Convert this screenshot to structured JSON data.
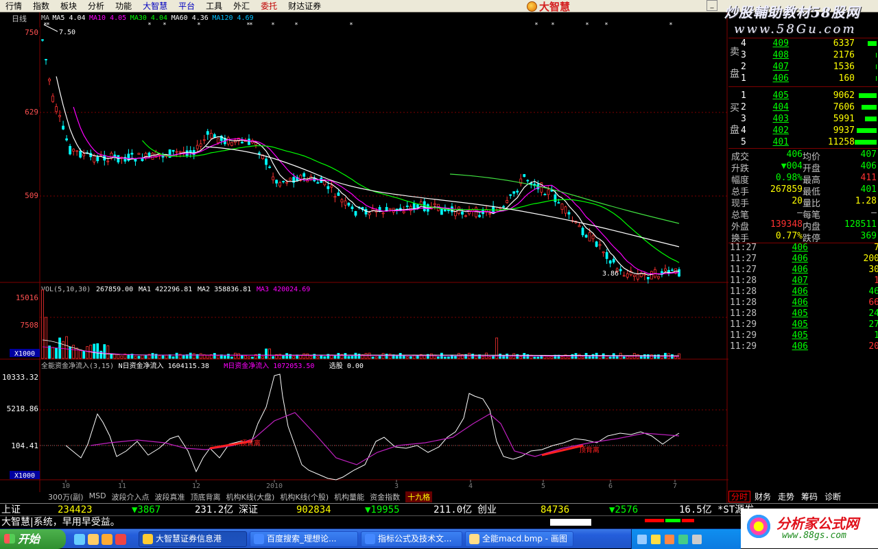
{
  "menu": [
    "行情",
    "指数",
    "板块",
    "分析",
    "功能",
    "大智慧",
    "平台",
    "工具",
    "外汇",
    "委托",
    "财达证券"
  ],
  "menu_colors": [
    "#000",
    "#000",
    "#000",
    "#000",
    "#000",
    "#0000c0",
    "#0000c0",
    "#000",
    "#000",
    "#c00000",
    "#000"
  ],
  "logo": "大智慧",
  "watermark": {
    "line1": "炒股輔助教材58股网",
    "line2": "www.58Gu.com"
  },
  "chart": {
    "period": "日线",
    "ma_legend": [
      {
        "text": "MA",
        "color": "#c0c0c0"
      },
      {
        "text": "MA5 4.04",
        "color": "#ffffff"
      },
      {
        "text": "MA10 4.05",
        "color": "#ff00ff"
      },
      {
        "text": "MA30 4.04",
        "color": "#00ff00"
      },
      {
        "text": "MA60 4.36",
        "color": "#ffffff"
      },
      {
        "text": "MA120 4.69",
        "color": "#00c0ff"
      }
    ],
    "price_axis": [
      "750",
      "629",
      "509"
    ],
    "high_note": "7.50",
    "low_note": "3.86",
    "vol_legend": [
      {
        "text": "VOL(5,10,30)",
        "color": "#c0c0c0"
      },
      {
        "text": "267859.00",
        "color": "#ffffff"
      },
      {
        "text": "MA1 422296.81",
        "color": "#ffffff"
      },
      {
        "text": "MA2 358836.81",
        "color": "#ffffff"
      },
      {
        "text": "MA3 420024.69",
        "color": "#ff00ff"
      }
    ],
    "vol_axis": [
      "15016",
      "7508",
      "X1000"
    ],
    "ind_legend": [
      {
        "text": "全能资金净流入(3,15)",
        "color": "#c0c0c0"
      },
      {
        "text": "N日资金净流入 1604115.38",
        "color": "#ffffff"
      },
      {
        "text": "M日资金净流入 1072053.50",
        "color": "#ff00ff"
      },
      {
        "text": "选股 0.00",
        "color": "#ffffff"
      }
    ],
    "ind_axis": [
      "10333.32",
      "5218.86",
      "104.41",
      "X1000"
    ],
    "divergence_label": "顶背离",
    "year_label": "2010",
    "date_ticks": [
      "10",
      "11",
      "12",
      "2010",
      "3",
      "4",
      "5",
      "6",
      "7"
    ],
    "colors": {
      "up": "#ff3232",
      "down": "#00ffff",
      "grid": "#800000",
      "ma5": "#ffffff",
      "ma10": "#ff00ff",
      "ma30": "#00ff00",
      "ma60": "#ffffff"
    }
  },
  "chart_data": {
    "type": "candlestick",
    "y_axis_ticks": [
      750,
      629,
      509
    ],
    "high": 7.5,
    "low": 3.86
  },
  "order_book": {
    "sell_label": "卖盘",
    "buy_label": "买盘",
    "sell": [
      {
        "level": "4",
        "price": "409",
        "vol": "6337",
        "bar": 0.42
      },
      {
        "level": "3",
        "price": "408",
        "vol": "2176",
        "bar": 0.04
      },
      {
        "level": "2",
        "price": "407",
        "vol": "1536",
        "bar": 0.03
      },
      {
        "level": "1",
        "price": "406",
        "vol": "160",
        "bar": 0.03
      }
    ],
    "buy": [
      {
        "level": "1",
        "price": "405",
        "vol": "9062",
        "bar": 0.82
      },
      {
        "level": "2",
        "price": "404",
        "vol": "7606",
        "bar": 0.68
      },
      {
        "level": "3",
        "price": "403",
        "vol": "5991",
        "bar": 0.52
      },
      {
        "level": "4",
        "price": "402",
        "vol": "9937",
        "bar": 0.9
      },
      {
        "level": "5",
        "price": "401",
        "vol": "11258",
        "bar": 1.0
      }
    ]
  },
  "stats": [
    {
      "k1": "成交",
      "v1": "406",
      "c1": "#00ff00",
      "k2": "均价",
      "v2": "407",
      "c2": "#00ff00"
    },
    {
      "k1": "升跌",
      "v1": "▼004",
      "c1": "#00ff00",
      "k2": "开盘",
      "v2": "406",
      "c2": "#00ff00"
    },
    {
      "k1": "幅度",
      "v1": "0.98%",
      "c1": "#00ff00",
      "k2": "最高",
      "v2": "411",
      "c2": "#ff3232"
    },
    {
      "k1": "总手",
      "v1": "267859",
      "c1": "#ffff00",
      "k2": "最低",
      "v2": "401",
      "c2": "#00ff00"
    },
    {
      "k1": "现手",
      "v1": "20",
      "c1": "#ffff00",
      "k2": "量比",
      "v2": "1.28",
      "c2": "#ffff00"
    },
    {
      "k1": "总笔",
      "v1": "—",
      "c1": "#c0c0c0",
      "k2": "每笔",
      "v2": "—",
      "c2": "#c0c0c0"
    },
    {
      "k1": "外盘",
      "v1": "139348",
      "c1": "#ff3232",
      "k2": "内盘",
      "v2": "128511",
      "c2": "#00ff00"
    },
    {
      "k1": "换手",
      "v1": "0.77%",
      "c1": "#ffff00",
      "k2": "跌停",
      "v2": "369",
      "c2": "#00ff00"
    }
  ],
  "ticks": [
    {
      "t": "11:27",
      "p": "406",
      "v": "7",
      "c": "#ffff00"
    },
    {
      "t": "11:27",
      "p": "406",
      "v": "200",
      "c": "#ffff00"
    },
    {
      "t": "11:27",
      "p": "406",
      "v": "30",
      "c": "#ffff00"
    },
    {
      "t": "11:28",
      "p": "407",
      "v": "1",
      "c": "#ff3232"
    },
    {
      "t": "11:28",
      "p": "406",
      "v": "46",
      "c": "#00ff00"
    },
    {
      "t": "11:28",
      "p": "406",
      "v": "66",
      "c": "#ff3232"
    },
    {
      "t": "11:28",
      "p": "405",
      "v": "24",
      "c": "#00ff00"
    },
    {
      "t": "11:29",
      "p": "405",
      "v": "27",
      "c": "#00ff00"
    },
    {
      "t": "11:29",
      "p": "405",
      "v": "1",
      "c": "#00ff00"
    },
    {
      "t": "11:29",
      "p": "406",
      "v": "20",
      "c": "#ff3232"
    }
  ],
  "side_tabs": [
    "分时",
    "财务",
    "走势",
    "筹码",
    "诊断"
  ],
  "bottom_tabs": [
    "300万(副)",
    "MSD",
    "波段介入点",
    "波段真准",
    "顶底背离",
    "机构K线(大盘)",
    "机构K线(个股)",
    "机构量能",
    "资金指数",
    "十九格"
  ],
  "status": {
    "sh_label": "上证",
    "sh_val": "234423",
    "sh_chg": "▼3867",
    "sh_amt": "231.2亿",
    "sz_label": "深证",
    "sz_val": "902834",
    "sz_chg": "▼19955",
    "sz_amt": "211.0亿",
    "cy_label": "创业",
    "cy_val": "84736",
    "cy_chg": "▼2576",
    "cy_amt": "16.5亿",
    "st_label": "*ST源发"
  },
  "message": "大智慧|系统，早用早受益。",
  "taskbar": {
    "start": "开始",
    "tasks": [
      "大智慧证券信息港",
      "百度搜索_理想论...",
      "指标公式及技术文...",
      "全能macd.bmp - 画图"
    ]
  },
  "brand_badge": {
    "name": "分析家公式网",
    "url": "www.88gs.com"
  }
}
